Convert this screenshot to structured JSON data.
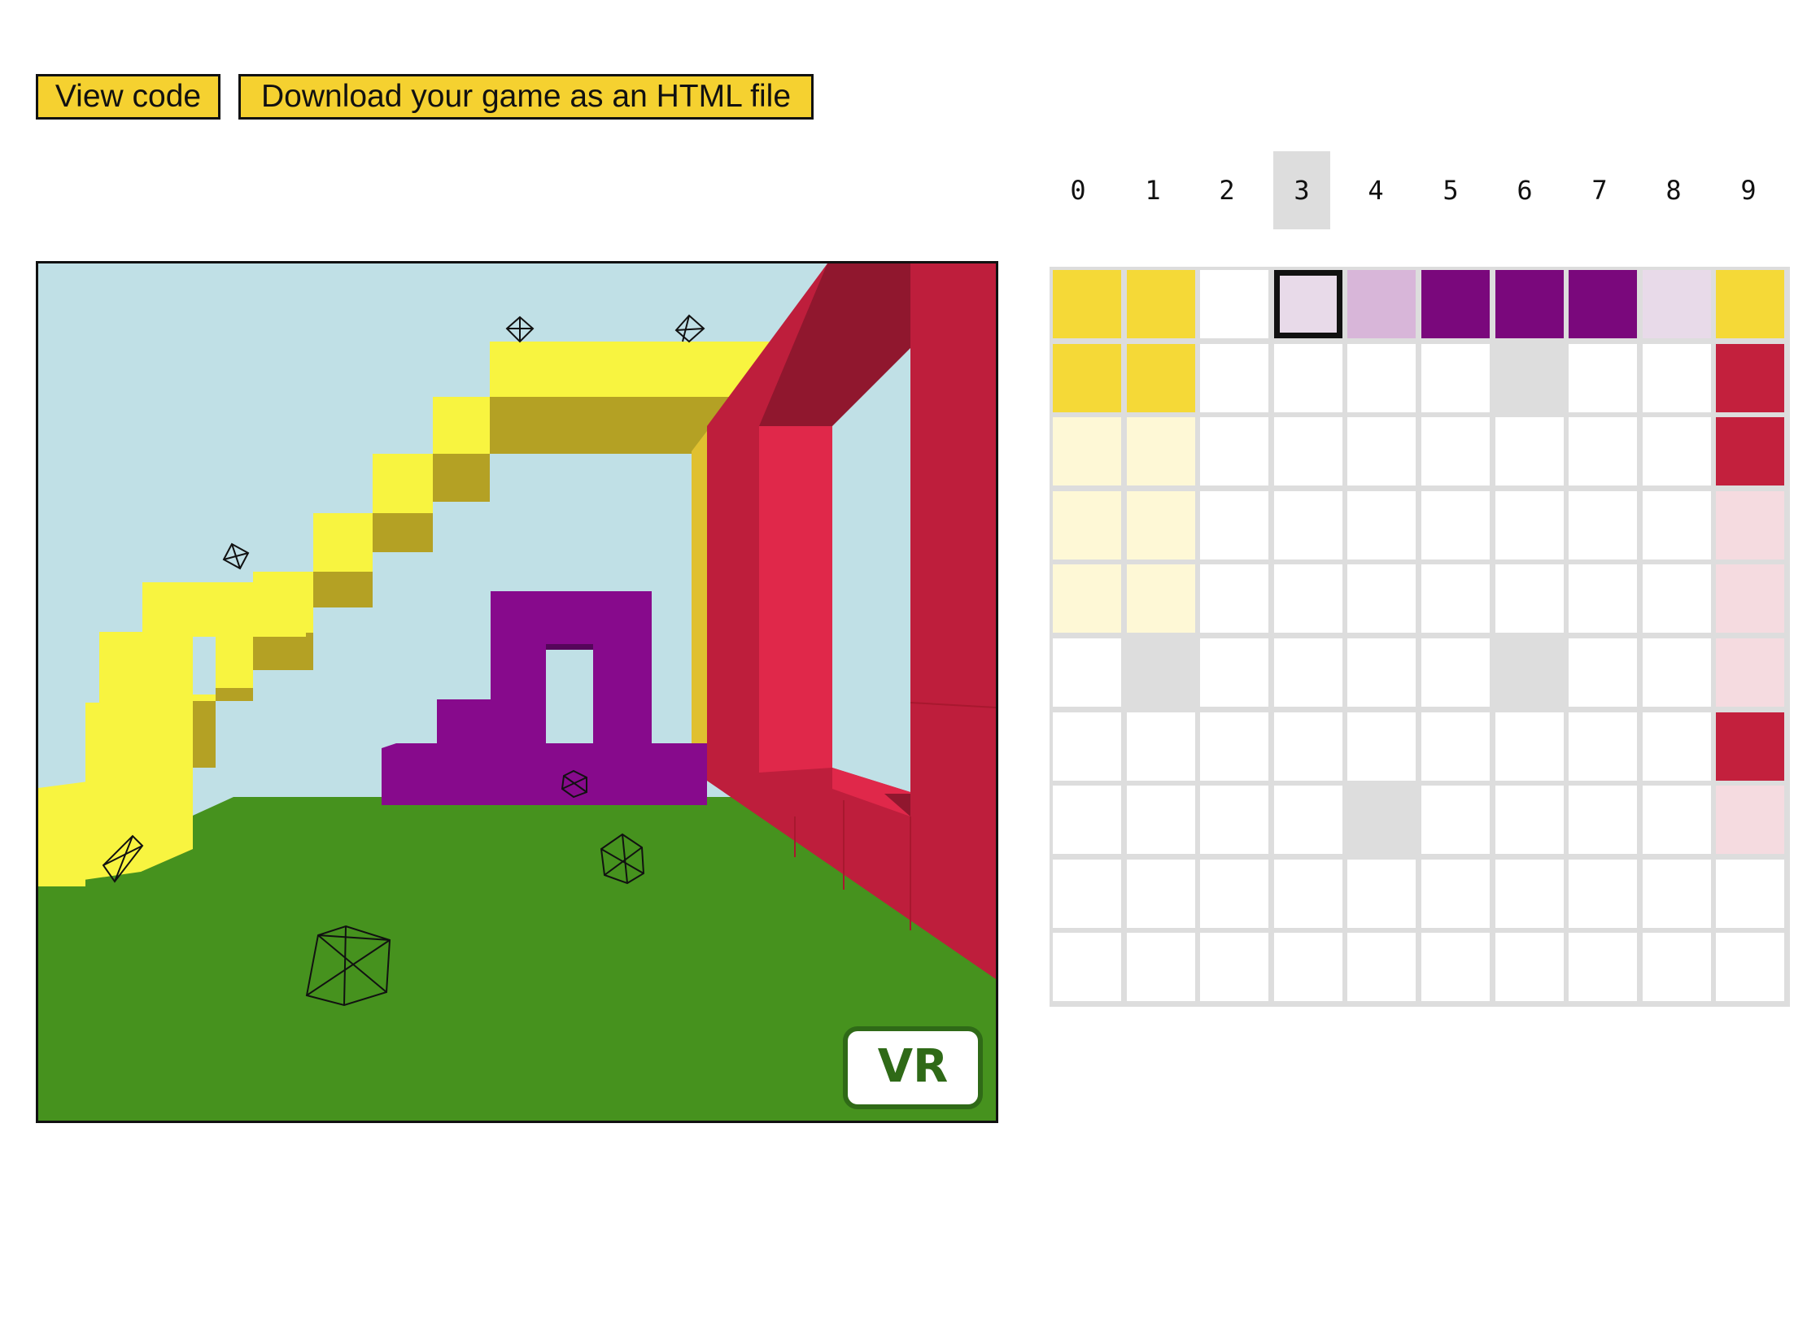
{
  "toolbar": {
    "view_code_label": "View code",
    "download_label": "Download your game as an HTML file"
  },
  "game_view": {
    "vr_label": "VR",
    "colors": {
      "sky": "#c0e0e6",
      "ground": "#46921e",
      "yellow": "#f8f440",
      "yellow_shade": "#b4a124",
      "purple": "#870a8c",
      "red": "#be1e3c",
      "red_light": "#e0284a",
      "red_dark": "#90172e"
    }
  },
  "palette": {
    "items": [
      "0",
      "1",
      "2",
      "3",
      "4",
      "5",
      "6",
      "7",
      "8",
      "9"
    ],
    "selected_index": 3
  },
  "map": {
    "colors": {
      "W": "#ffffff",
      "G": "#dddddd",
      "Y": "#f5d937",
      "y": "#fef8d6",
      "R": "#c3203d",
      "r": "#f5dbe0",
      "P": "#7a087c",
      "p": "#d8b6d9",
      "l": "#e8dae9"
    },
    "rows": [
      [
        "Y",
        "Y",
        "W",
        "l",
        "p",
        "P",
        "P",
        "P",
        "l",
        "Y"
      ],
      [
        "Y",
        "Y",
        "W",
        "W",
        "W",
        "W",
        "G",
        "W",
        "W",
        "R"
      ],
      [
        "y",
        "y",
        "W",
        "W",
        "W",
        "W",
        "W",
        "W",
        "W",
        "R"
      ],
      [
        "y",
        "y",
        "W",
        "W",
        "W",
        "W",
        "W",
        "W",
        "W",
        "r"
      ],
      [
        "y",
        "y",
        "W",
        "W",
        "W",
        "W",
        "W",
        "W",
        "W",
        "r"
      ],
      [
        "W",
        "G",
        "W",
        "W",
        "W",
        "W",
        "G",
        "W",
        "W",
        "r"
      ],
      [
        "W",
        "W",
        "W",
        "W",
        "W",
        "W",
        "W",
        "W",
        "W",
        "R"
      ],
      [
        "W",
        "W",
        "W",
        "W",
        "G",
        "W",
        "W",
        "W",
        "W",
        "r"
      ],
      [
        "W",
        "W",
        "W",
        "W",
        "W",
        "W",
        "W",
        "W",
        "W",
        "W"
      ],
      [
        "W",
        "W",
        "W",
        "W",
        "W",
        "W",
        "W",
        "W",
        "W",
        "W"
      ]
    ],
    "selected_cell": [
      0,
      3
    ]
  }
}
